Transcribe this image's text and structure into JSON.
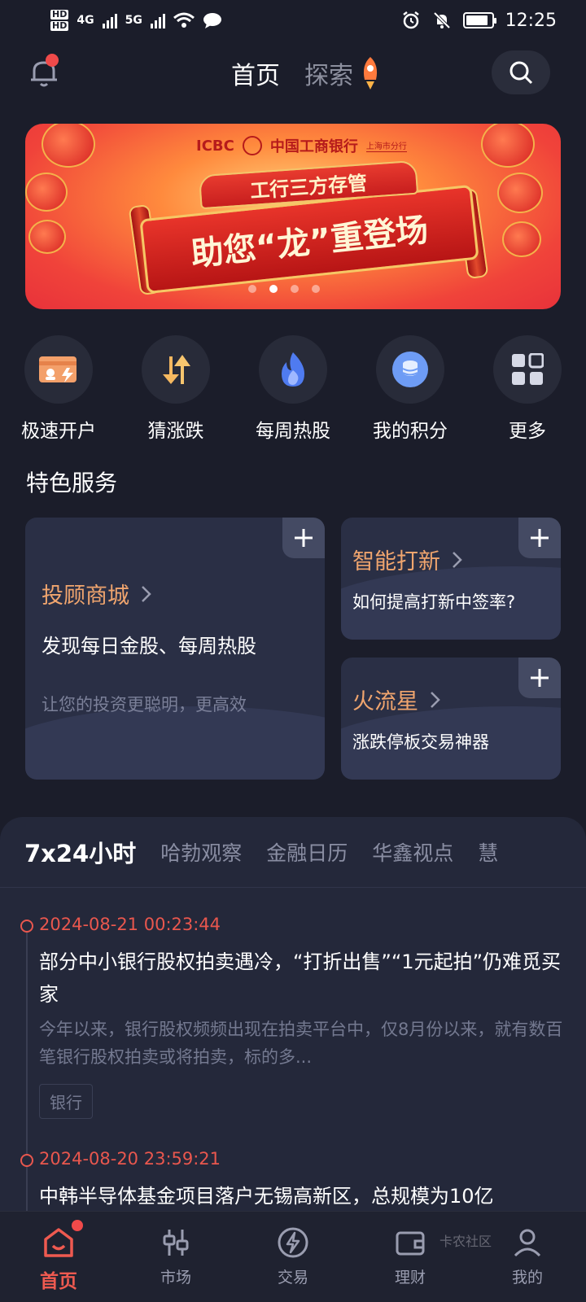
{
  "status_bar": {
    "time": "12:25",
    "network_1": "4G",
    "network_2": "5G"
  },
  "header": {
    "tab_home": "首页",
    "tab_explore": "探索"
  },
  "banner": {
    "brand_en": "ICBC",
    "brand_cn": "中国工商银行",
    "branch": "上海市分行",
    "ribbon_top": "工行三方存管",
    "ribbon_main": "助您“龙”重登场",
    "active_slide": 2,
    "slide_count": 4
  },
  "quick_actions": [
    {
      "label": "极速开户",
      "icon": "account-card-icon"
    },
    {
      "label": "猜涨跌",
      "icon": "up-down-arrows-icon"
    },
    {
      "label": "每周热股",
      "icon": "flame-icon"
    },
    {
      "label": "我的积分",
      "icon": "coin-stack-icon"
    },
    {
      "label": "更多",
      "icon": "grid-icon"
    }
  ],
  "services": {
    "title": "特色服务",
    "cards": [
      {
        "title": "投顾商城",
        "subtitle": "发现每日金股、每周热股",
        "desc": "让您的投资更聪明，更高效"
      },
      {
        "title": "智能打新",
        "subtitle": "如何提高打新中签率?"
      },
      {
        "title": "火流星",
        "subtitle": "涨跌停板交易神器"
      }
    ]
  },
  "news": {
    "tabs": [
      "7x24小时",
      "哈勃观察",
      "金融日历",
      "华鑫视点",
      "慧"
    ],
    "items": [
      {
        "time": "2024-08-21 00:23:44",
        "title": "部分中小银行股权拍卖遇冷，“打折出售”“1元起拍”仍难觅买家",
        "summary": "今年以来，银行股权频频出现在拍卖平台中，仅8月份以来，就有数百笔银行股权拍卖或将拍卖，标的多...",
        "tag": "银行"
      },
      {
        "time": "2024-08-20 23:59:21",
        "title": "中韩半导体基金项目落户无锡高新区，总规模为10亿"
      }
    ]
  },
  "bottom_nav": [
    {
      "label": "首页",
      "active": true
    },
    {
      "label": "市场"
    },
    {
      "label": "交易"
    },
    {
      "label": "理财"
    },
    {
      "label": "我的"
    }
  ],
  "watermark": "卡农社区",
  "colors": {
    "accent": "#ef5a50",
    "card_title": "#f0a56e",
    "background": "#1b1d2a"
  }
}
